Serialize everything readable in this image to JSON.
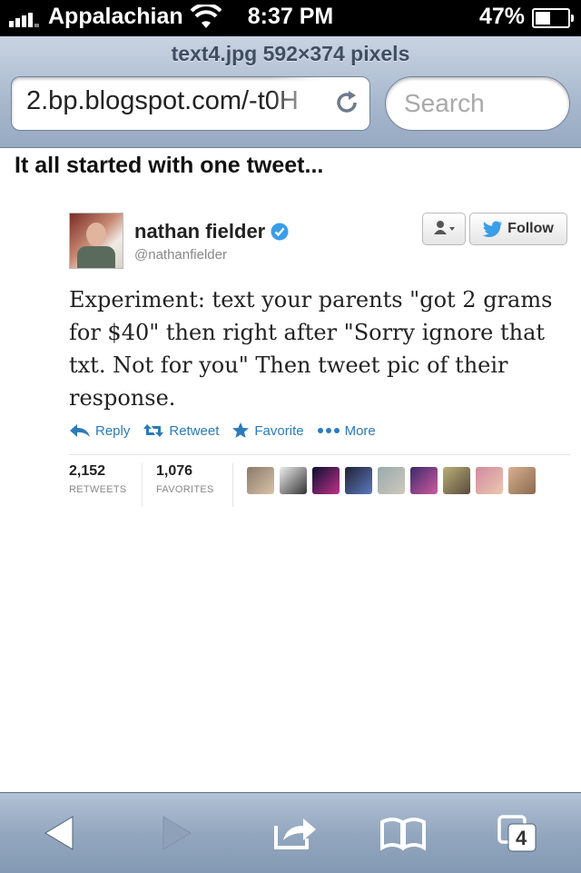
{
  "status_bar": {
    "carrier": "Appalachian",
    "time": "8:37 PM",
    "battery_percent": "47%",
    "battery_level": 0.47,
    "signal_bars": 4,
    "icons": [
      "signal-icon",
      "wifi-icon",
      "battery-icon"
    ]
  },
  "browser": {
    "page_title": "text4.jpg 592×374 pixels",
    "url": "2.bp.blogspot.com/-t0H",
    "search_placeholder": "Search",
    "tab_count": "4"
  },
  "content": {
    "headline": "It all started with one tweet...",
    "tweet": {
      "name": "nathan fielder",
      "handle": "@nathanfielder",
      "follow_label": "Follow",
      "text": "Experiment: text your parents \"got 2 grams for $40\" then right after \"Sorry ignore that txt. Not for you\" Then tweet pic of their response.",
      "actions": {
        "reply": "Reply",
        "retweet": "Retweet",
        "favorite": "Favorite",
        "more": "More"
      },
      "retweets_count": "2,152",
      "retweets_label": "RETWEETS",
      "favorites_count": "1,076",
      "favorites_label": "FAVORITES"
    }
  },
  "colors": {
    "link_blue": "#2b7bb9",
    "verified_blue": "#3a9ee8",
    "toolbar_blue": "#9aaec6"
  }
}
